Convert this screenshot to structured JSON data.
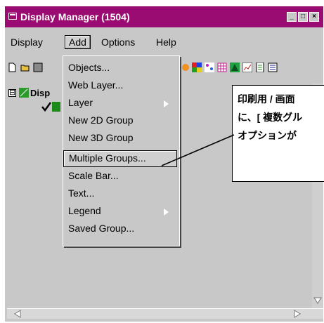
{
  "window": {
    "title": "Display Manager (1504)",
    "title_color": "#9a0c72",
    "buttons": [
      "minimize-icon",
      "maximize-icon",
      "close-icon"
    ]
  },
  "menubar": {
    "items": [
      "Display",
      "Add",
      "Options",
      "Help"
    ],
    "active": "Add"
  },
  "toolbar": {
    "icons": [
      "new-file-icon",
      "open-folder-icon",
      "save-icon",
      "draw-icon",
      "colorgrid-icon",
      "scatter-icon",
      "grid-icon",
      "tree-icon",
      "chart-icon",
      "document-icon",
      "list-icon"
    ]
  },
  "tree": {
    "root_label": "Disp",
    "expander": "⊟"
  },
  "add_menu": {
    "items": [
      {
        "label": "Objects...",
        "submenu": false
      },
      {
        "label": "Web Layer...",
        "submenu": false
      },
      {
        "label": "Layer",
        "submenu": true
      },
      {
        "label": "New 2D Group",
        "submenu": false
      },
      {
        "label": "New 3D Group",
        "submenu": false
      },
      {
        "label": "Multiple Groups...",
        "submenu": false
      },
      {
        "label": "Scale Bar...",
        "submenu": false
      },
      {
        "label": "Text...",
        "submenu": false
      },
      {
        "label": "Legend",
        "submenu": true
      },
      {
        "label": "Saved Group...",
        "submenu": false
      }
    ],
    "selected_index": 5
  },
  "callout": {
    "lines": [
      "印刷用 / 画面",
      "に、[ 複数グル",
      "オプションが"
    ]
  }
}
